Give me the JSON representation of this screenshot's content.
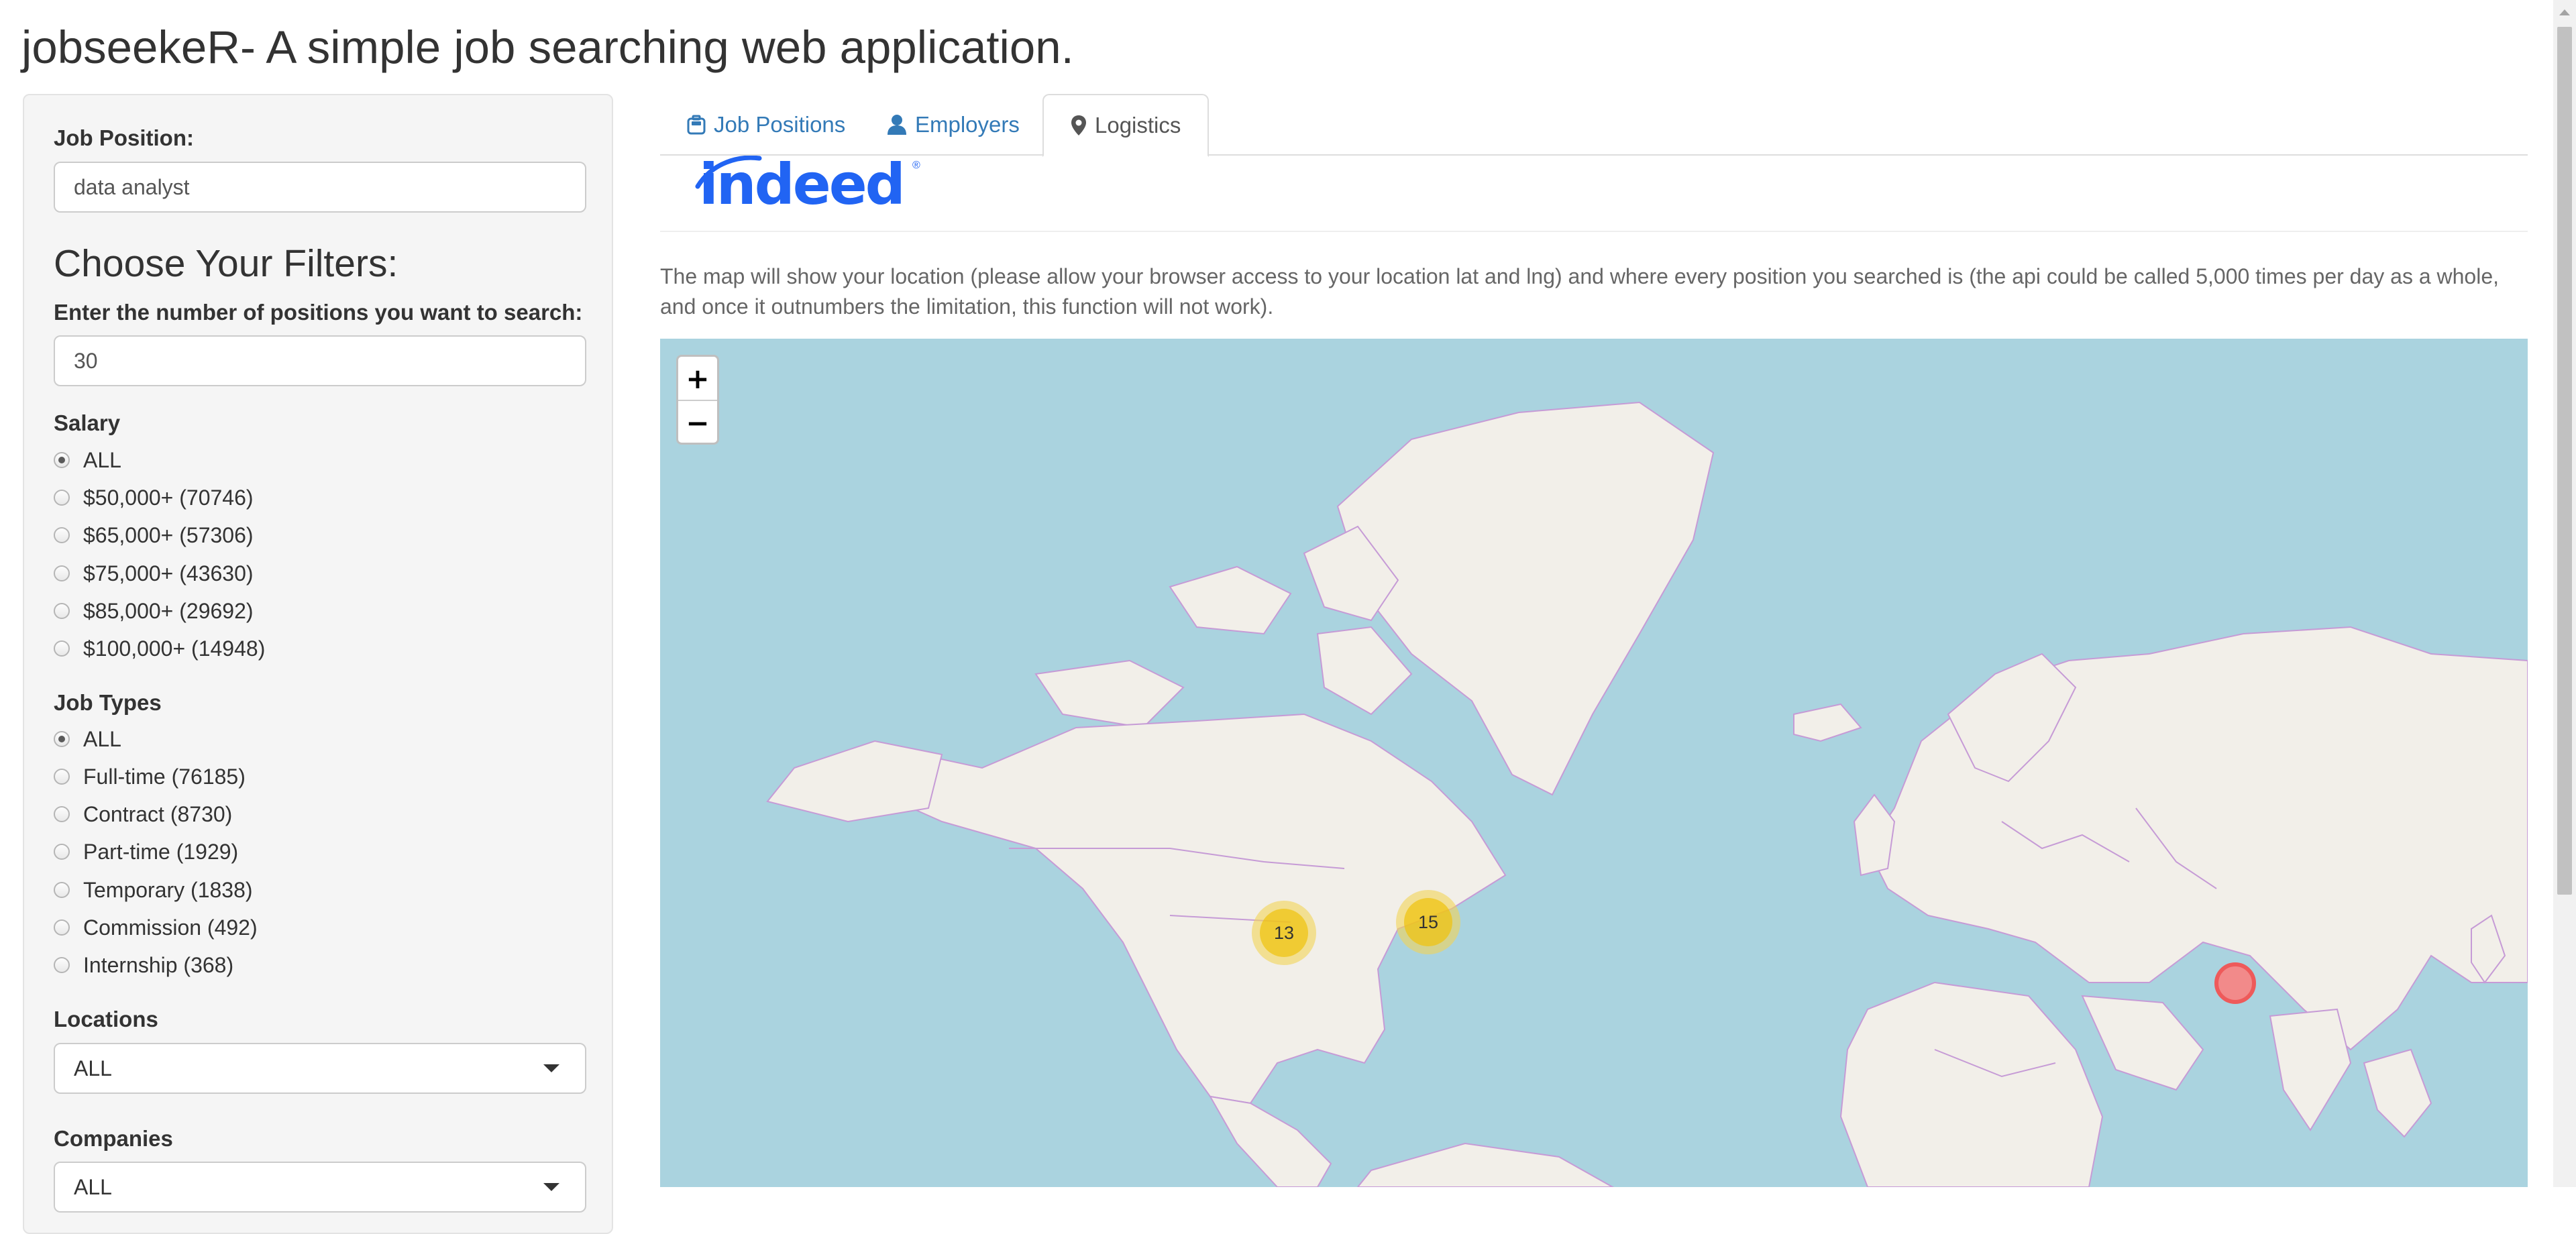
{
  "app": {
    "title": "jobseekeR- A simple job searching web application."
  },
  "sidebar": {
    "job_position_label": "Job Position:",
    "job_position_value": "data analyst",
    "filters_heading": "Choose Your Filters:",
    "num_positions_label": "Enter the number of positions you want to search:",
    "num_positions_value": "30",
    "salary": {
      "label": "Salary",
      "options": [
        "ALL",
        "$50,000+ (70746)",
        "$65,000+ (57306)",
        "$75,000+ (43630)",
        "$85,000+ (29692)",
        "$100,000+ (14948)"
      ],
      "selected": "ALL"
    },
    "job_types": {
      "label": "Job Types",
      "options": [
        "ALL",
        "Full-time (76185)",
        "Contract (8730)",
        "Part-time (1929)",
        "Temporary (1838)",
        "Commission (492)",
        "Internship (368)"
      ],
      "selected": "ALL"
    },
    "locations": {
      "label": "Locations",
      "value": "ALL"
    },
    "companies": {
      "label": "Companies",
      "value": "ALL"
    }
  },
  "tabs": [
    {
      "label": "Job Positions",
      "icon": "briefcase-icon",
      "active": false
    },
    {
      "label": "Employers",
      "icon": "user-icon",
      "active": false
    },
    {
      "label": "Logistics",
      "icon": "map-marker-icon",
      "active": true
    }
  ],
  "logo": {
    "text": "indeed",
    "registered": "®"
  },
  "description": "The map will show your location (please allow your browser access to your location lat and lng) and where every position you searched is (the api could be called 5,000 times per day as a whole, and once it outnumbers the limitation, this function will not work).",
  "map": {
    "zoom_in": "+",
    "zoom_out": "−",
    "clusters": [
      {
        "count": "13",
        "region": "western-us"
      },
      {
        "count": "15",
        "region": "eastern-us"
      }
    ],
    "user_marker": {
      "region": "southern-china"
    },
    "colors": {
      "water": "#aad3df",
      "land": "#f2efe9",
      "borders": "#c69bd6",
      "cluster": "#f0c20c",
      "marker": "#ee5a5a"
    }
  }
}
